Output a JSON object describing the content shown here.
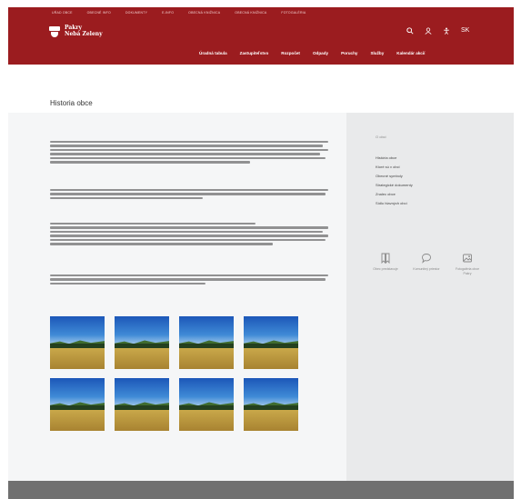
{
  "header": {
    "utility_links": [
      "Uŕad obce",
      "Obecné Info",
      "Dokumenty",
      "E-info",
      "Obecná knižnica",
      "Obecná knižnica",
      "Fotogaléria"
    ],
    "logo_line1": "Pakry",
    "logo_line2": "Nebá Zeleny",
    "nav": [
      "Úradná tabula",
      "Zastupiteľstvo",
      "Rozpočet",
      "Odpady",
      "Poruchy",
      "Služby",
      "Kalendár akcií"
    ],
    "icons": [
      "search-icon",
      "user-icon",
      "accessibility-icon",
      "language-icon"
    ],
    "language_label": "SK"
  },
  "page": {
    "title": "Historia obce"
  },
  "sidebar": {
    "heading": "O obci",
    "links": [
      "História obce",
      "Ktoré sú v obci",
      "Obecné symboly",
      "Strategické dokumenty",
      "Znalec obce",
      "Sídlo hlavných obcí"
    ],
    "cards": [
      {
        "icon": "bookmark-icon",
        "label": "Obec predstavuje"
      },
      {
        "icon": "chat-icon",
        "label": "Komunitný priestor"
      },
      {
        "icon": "image-icon",
        "label": "Fotogaléria obce Pakry"
      }
    ]
  },
  "colors": {
    "brand": "#9b1c1f",
    "content_bg": "#f5f6f7",
    "sidebar_bg": "#e9eaeb",
    "footer_bg": "#707070"
  }
}
